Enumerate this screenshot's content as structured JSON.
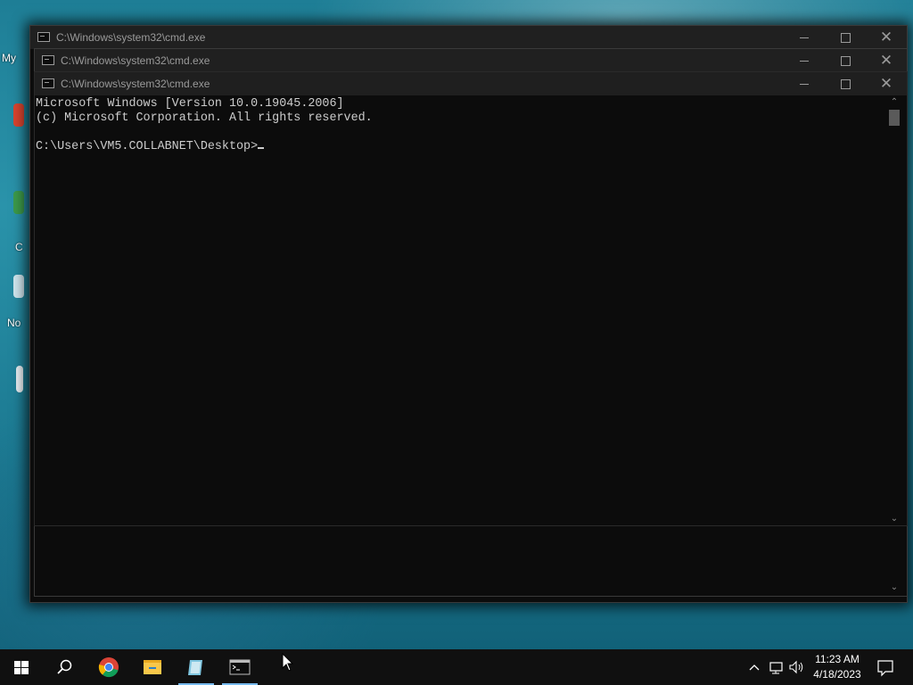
{
  "desktop": {
    "icons": [
      {
        "label": "My"
      },
      {
        "label": ""
      },
      {
        "label": "C"
      },
      {
        "label": "No"
      }
    ]
  },
  "windows": [
    {
      "title": "C:\\Windows\\system32\\cmd.exe"
    },
    {
      "title": "C:\\Windows\\system32\\cmd.exe"
    },
    {
      "title": "C:\\Windows\\system32\\cmd.exe"
    }
  ],
  "console": {
    "lines": [
      "Microsoft Windows [Version 10.0.19045.2006]",
      "(c) Microsoft Corporation. All rights reserved.",
      "",
      "C:\\Users\\VM5.COLLABNET\\Desktop>"
    ]
  },
  "taskbar": {
    "items": [
      {
        "icon": "windows-start-icon"
      },
      {
        "icon": "search-icon"
      },
      {
        "icon": "chrome-icon"
      },
      {
        "icon": "file-explorer-icon"
      },
      {
        "icon": "notepad-icon"
      },
      {
        "icon": "cmd-icon"
      }
    ],
    "clock": {
      "time": "11:23 AM",
      "date": "4/18/2023"
    }
  },
  "colors": {
    "accent": "#76b9ed",
    "console_bg": "#0c0c0c",
    "console_text": "#cccccc"
  }
}
